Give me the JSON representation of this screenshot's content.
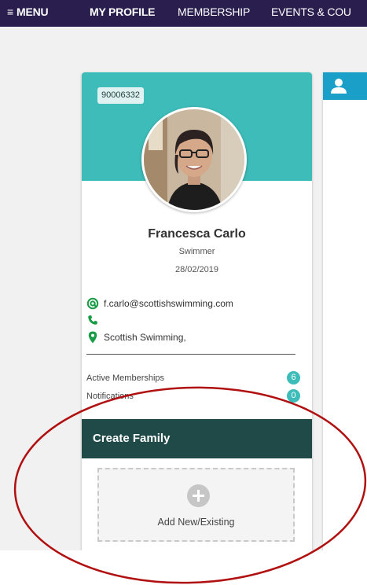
{
  "nav": {
    "menu_label": "MENU",
    "profile_label": "MY PROFILE",
    "membership_label": "MEMBERSHIP",
    "events_label": "EVENTS & COU"
  },
  "profile": {
    "member_id": "90006332",
    "name": "Francesca Carlo",
    "role": "Swimmer",
    "date": "28/02/2019",
    "email": "f.carlo@scottishswimming.com",
    "phone": "",
    "address": "Scottish Swimming,"
  },
  "stats": {
    "memberships_label": "Active Memberships",
    "memberships_count": "6",
    "notifications_label": "Notifications",
    "notifications_count": "0"
  },
  "family": {
    "title": "Create Family",
    "add_label": "Add New/Existing"
  },
  "icons": {
    "menu": "menu-icon",
    "email": "at-icon",
    "phone": "phone-icon",
    "address": "map-pin-icon",
    "add": "plus-icon",
    "user": "user-icon"
  },
  "colors": {
    "nav_bg": "#2a1e4f",
    "card_header": "#3dbcb9",
    "family_bar": "#1f4a47",
    "icon_green": "#179b45",
    "side_header": "#1aa0c8",
    "annotation_red": "#b01010"
  }
}
